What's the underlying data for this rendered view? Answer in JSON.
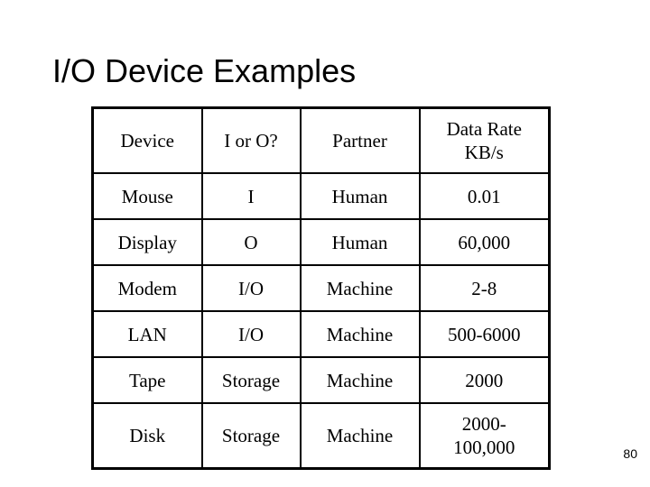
{
  "slide": {
    "title": "I/O Device Examples",
    "page_number": "80",
    "background_color": "#ffffff",
    "text_color": "#000000",
    "border_color": "#000000"
  },
  "table": {
    "headers": [
      {
        "line1": "Device",
        "line2": ""
      },
      {
        "line1": "I or O?",
        "line2": ""
      },
      {
        "line1": "Partner",
        "line2": ""
      },
      {
        "line1": "Data Rate",
        "line2": "KB/s"
      }
    ],
    "rows": [
      {
        "device": "Mouse",
        "io": "I",
        "partner": "Human",
        "rate_line1": "0.01",
        "rate_line2": ""
      },
      {
        "device": "Display",
        "io": "O",
        "partner": "Human",
        "rate_line1": "60,000",
        "rate_line2": ""
      },
      {
        "device": "Modem",
        "io": "I/O",
        "partner": "Machine",
        "rate_line1": "2-8",
        "rate_line2": ""
      },
      {
        "device": "LAN",
        "io": "I/O",
        "partner": "Machine",
        "rate_line1": "500-6000",
        "rate_line2": ""
      },
      {
        "device": "Tape",
        "io": "Storage",
        "partner": "Machine",
        "rate_line1": "2000",
        "rate_line2": ""
      },
      {
        "device": "Disk",
        "io": "Storage",
        "partner": "Machine",
        "rate_line1": "2000-",
        "rate_line2": "100,000"
      }
    ]
  }
}
